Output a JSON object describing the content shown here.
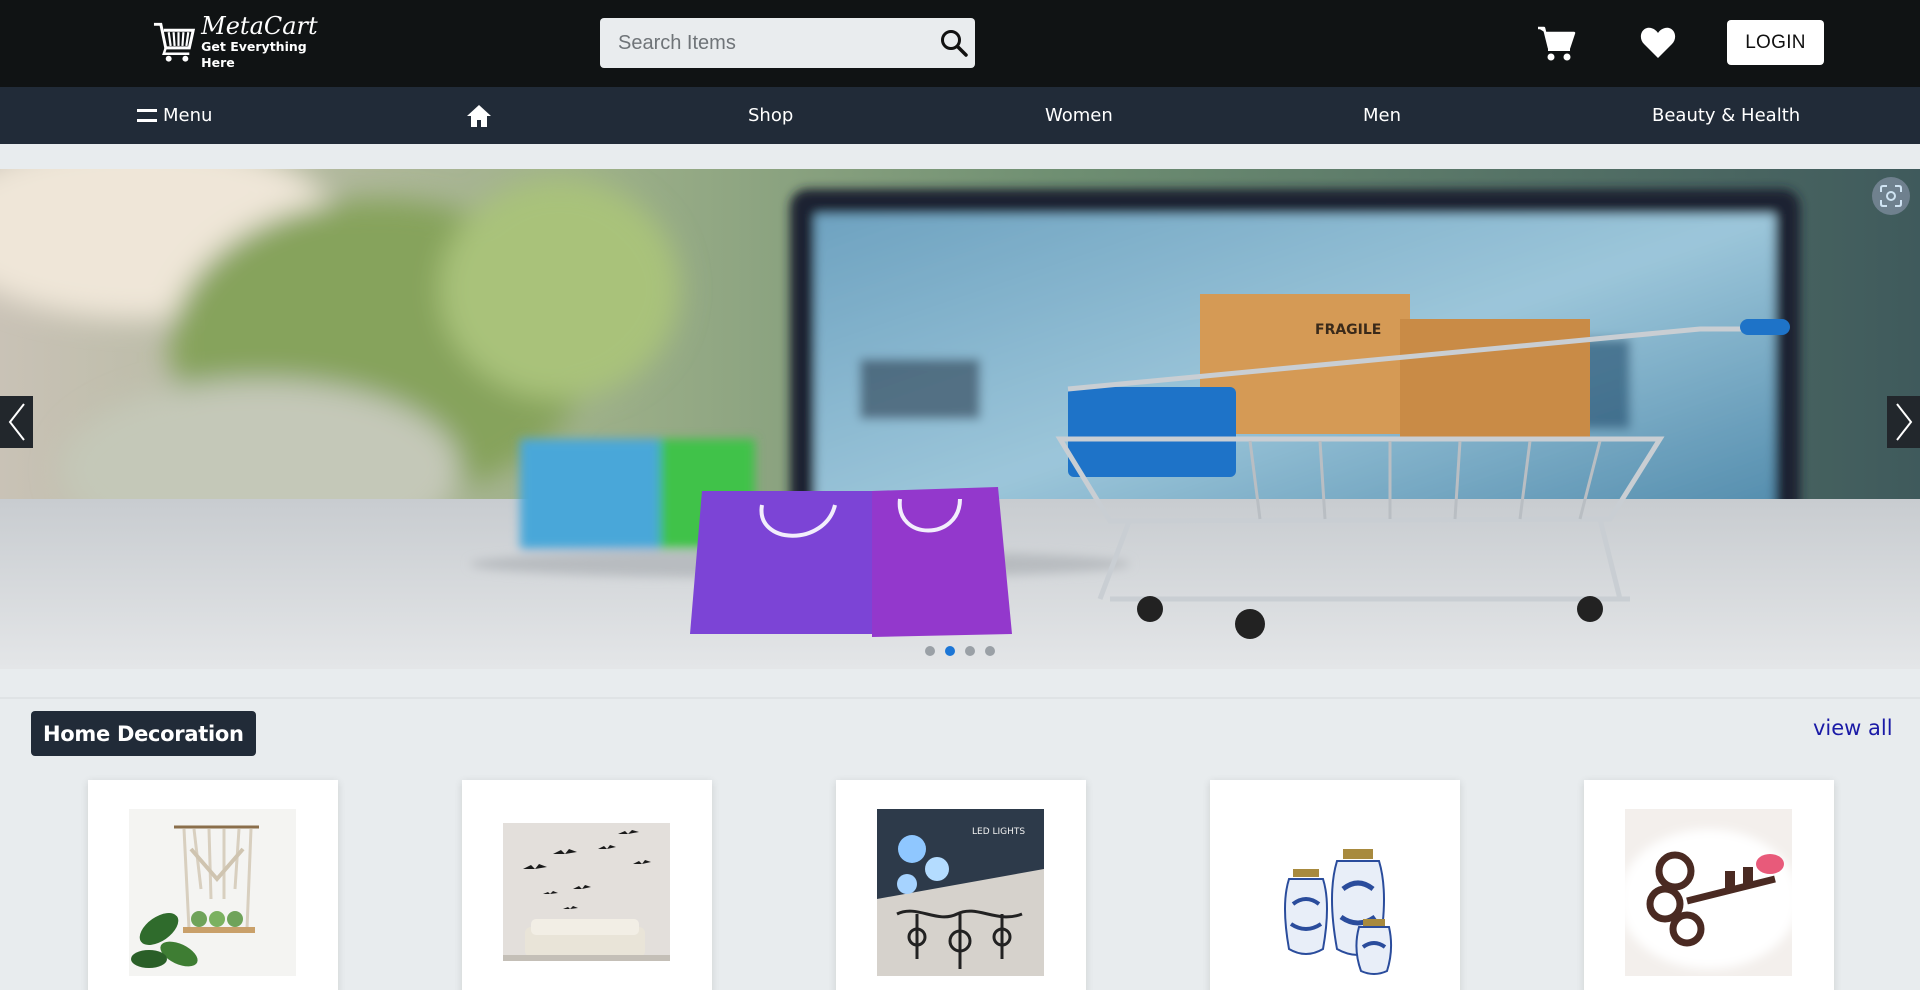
{
  "header": {
    "logo_name": "MetaCart",
    "logo_tagline": "Get Everything Here",
    "search_placeholder": "Search Items",
    "login_label": "LOGIN"
  },
  "nav": {
    "menu_label": "Menu",
    "items": [
      "Shop",
      "Women",
      "Men",
      "Beauty & Health"
    ]
  },
  "carousel": {
    "slide_count": 4,
    "active_slide": 2
  },
  "section": {
    "title": "Home Decoration",
    "view_all": "view all",
    "products": [
      {
        "icon": "macrame-shelf-image"
      },
      {
        "icon": "bird-wall-decal-image"
      },
      {
        "icon": "led-wall-lamp-image"
      },
      {
        "icon": "ceramic-jars-image"
      },
      {
        "icon": "vintage-key-image"
      }
    ]
  },
  "colors": {
    "topbar": "#101314",
    "navbar": "#212b38",
    "page_bg": "#e8ecee",
    "active_dot": "#1c76d6",
    "view_all_link": "#1a1aa6"
  }
}
